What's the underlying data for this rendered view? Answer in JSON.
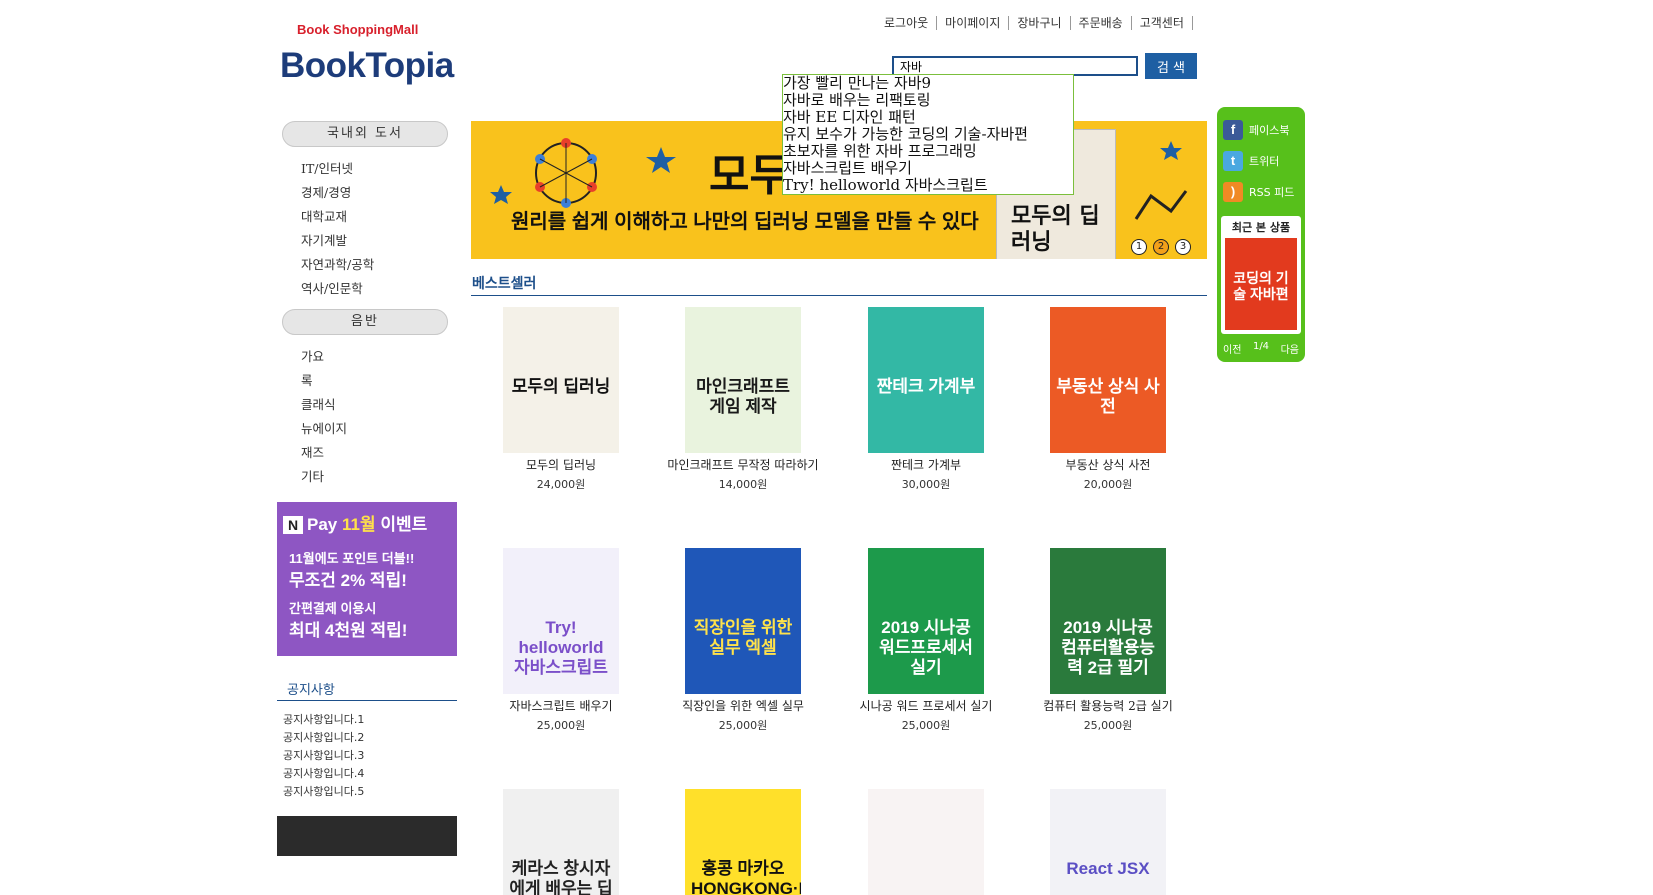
{
  "header": {
    "logo_tagline": "Book ShoppingMall",
    "logo_name": "BookTopia",
    "nav": [
      "로그아웃",
      "마이페이지",
      "장바구니",
      "주문배송",
      "고객센터"
    ]
  },
  "search": {
    "value": "자바",
    "button_label": "검 색",
    "suggestions": [
      "가장 빨리 만나는 자바9",
      "자바로 배우는 리팩토링",
      "자바 EE 디자인 패턴",
      "유지 보수가 가능한 코딩의 기술-자바편",
      "초보자를 위한 자바 프로그래밍",
      "자바스크립트 배우기",
      "Try! helloworld 자바스크립트"
    ]
  },
  "sidebar": {
    "domestic_header": "국내외 도서",
    "domestic_items": [
      "IT/인터넷",
      "경제/경영",
      "대학교재",
      "자기계발",
      "자연과학/공학",
      "역사/인문학"
    ],
    "music_header": "음반",
    "music_items": [
      "가요",
      "록",
      "클래식",
      "뉴에이지",
      "재즈",
      "기타"
    ],
    "event": {
      "line1_prefix": "Pay",
      "line1_month": "11월",
      "line1_suffix": "이벤트",
      "line2": "11월에도 포인트 더블!!",
      "line3": "무조건 2% 적립!",
      "line4": "간편결제 이용시",
      "line5": "최대 4천원 적립!"
    },
    "notice_title": "공지사항",
    "notices": [
      "공지사항입니다.1",
      "공지사항입니다.2",
      "공지사항입니다.3",
      "공지사항입니다.4",
      "공지사항입니다.5"
    ]
  },
  "banner": {
    "title": "모두의 딥러닝",
    "subtitle": "원리를 쉽게 이해하고 나만의 딥러닝 모델을 만들 수 있다",
    "book_label": "모두의 딥러닝",
    "dots": [
      "1",
      "2",
      "3"
    ],
    "active_dot": 2
  },
  "bestseller": {
    "title": "베스트셀러",
    "products": [
      {
        "name": "모두의 딥러닝",
        "price": "24,000원",
        "cover_text": "모두의 딥러닝",
        "cover_color": "#f4f1e8",
        "text_color": "#111111"
      },
      {
        "name": "마인크래프트 무작정 따라하기",
        "price": "14,000원",
        "cover_text": "마인크래프트 게임 제작",
        "cover_color": "#e9f3de",
        "text_color": "#1a1a1a"
      },
      {
        "name": "짠테크 가계부",
        "price": "30,000원",
        "cover_text": "짠테크 가계부",
        "cover_color": "#33b8a5",
        "text_color": "#ffffff"
      },
      {
        "name": "부동산 상식 사전",
        "price": "20,000원",
        "cover_text": "부동산 상식 사전",
        "cover_color": "#ec5a25",
        "text_color": "#ffffff"
      },
      {
        "name": "자바스크립트 배우기",
        "price": "25,000원",
        "cover_text": "Try! helloworld 자바스크립트",
        "cover_color": "#f2f0fa",
        "text_color": "#7b4fc9"
      },
      {
        "name": "직장인을 위한 엑셀 실무",
        "price": "25,000원",
        "cover_text": "직장인을 위한 실무 엑셀",
        "cover_color": "#1f57b8",
        "text_color": "#ffe24a"
      },
      {
        "name": "시나공 워드 프로세서 실기",
        "price": "25,000원",
        "cover_text": "2019 시나공 워드프로세서 실기",
        "cover_color": "#1d9a4b",
        "text_color": "#ffffff"
      },
      {
        "name": "컴퓨터 활용능력 2급 실기",
        "price": "25,000원",
        "cover_text": "2019 시나공 컴퓨터활용능력 2급 필기",
        "cover_color": "#2a7a3c",
        "text_color": "#ffffff"
      },
      {
        "name": "",
        "price": "",
        "cover_text": "케라스 창시자에게 배우는 딥러닝",
        "cover_color": "#f0f0f0",
        "text_color": "#222222"
      },
      {
        "name": "",
        "price": "",
        "cover_text": "홍콩 마카오 HONGKONG·MACAO",
        "cover_color": "#ffe02a",
        "text_color": "#111111"
      },
      {
        "name": "",
        "price": "",
        "cover_text": "",
        "cover_color": "#f8f3f3",
        "text_color": "#222222"
      },
      {
        "name": "",
        "price": "",
        "cover_text": "React JSX",
        "cover_color": "#f2f2f6",
        "text_color": "#5b4fc4"
      }
    ]
  },
  "side_widget": {
    "facebook": "페이스북",
    "twitter": "트위터",
    "rss": "RSS 피드",
    "recent_title": "최근 본 상품",
    "recent_book": "코딩의 기술 자바편",
    "prev": "이전",
    "page": "1/4",
    "next": "다음"
  },
  "colors": {
    "accent": "#1d4f8a",
    "button": "#1e5fa3",
    "widget": "#57c01b",
    "banner": "#f9c21c",
    "event": "#8e56c3"
  }
}
